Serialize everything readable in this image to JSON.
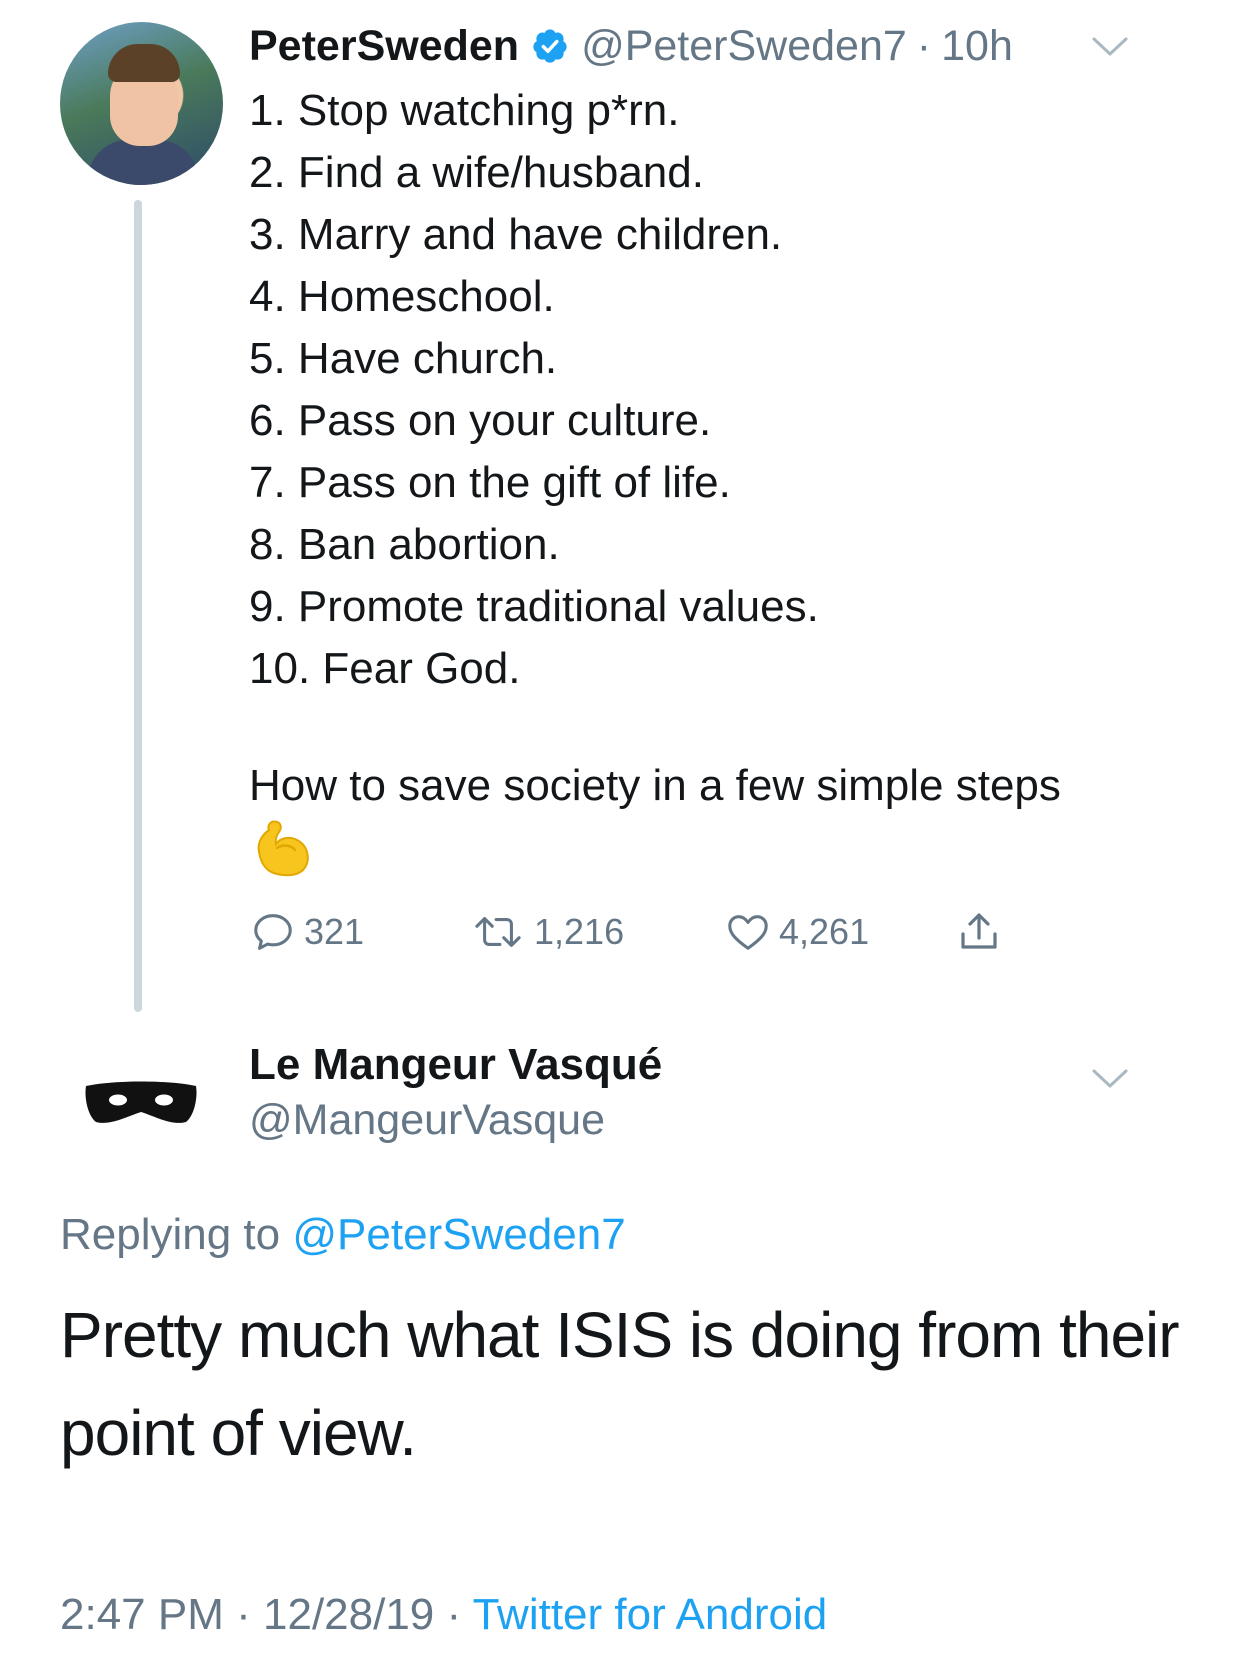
{
  "tweet": {
    "display_name": "PeterSweden",
    "handle": "@PeterSweden7",
    "separator": "·",
    "time": "10h",
    "lines": [
      "1. Stop watching p*rn.",
      "2. Find a wife/husband.",
      "3. Marry and have children.",
      "4. Homeschool.",
      "5. Have church.",
      "6. Pass on your culture.",
      "7. Pass on the gift of life.",
      "8. Ban abortion.",
      "9. Promote traditional values.",
      "10. Fear God."
    ],
    "closing_text": "How to save society in a few simple steps",
    "emoji": "flexed-biceps-emoji",
    "replies": "321",
    "retweets": "1,216",
    "likes": "4,261"
  },
  "reply": {
    "display_name": "Le Mangeur Vasqué",
    "handle": "@MangeurVasque",
    "replying_prefix": "Replying to",
    "replying_to": "@PeterSweden7",
    "text": "Pretty much what ISIS is doing from their point of view.",
    "time": "2:47 PM",
    "sep1": "·",
    "date": "12/28/19",
    "sep2": "·",
    "source": "Twitter for Android"
  },
  "colors": {
    "text": "#14171a",
    "secondary": "#657786",
    "link": "#1da1f2",
    "thread_line": "#ccd6dd",
    "verified": "#1da1f2"
  }
}
